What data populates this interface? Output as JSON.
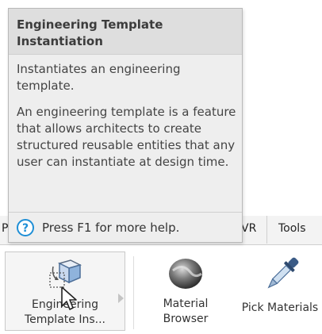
{
  "tooltip": {
    "title": "Engineering Template Instantiation",
    "description": "Instantiates an engineering template.",
    "details": "An engineering template is a feature that allows architects to create structured reusable entities that any user can instantiate at design time.",
    "help_text": "Press F1 for more help."
  },
  "ribbon": {
    "tabs": {
      "left_clipped": "P",
      "vr": "VR",
      "tools": "Tools"
    },
    "buttons": {
      "engineering_template": "Engineering Template Ins...",
      "material_browser": "Material Browser",
      "pick_materials": "Pick Materials"
    }
  },
  "colors": {
    "help_icon": "#1f8fd6",
    "tooltip_bg": "#eeeeee",
    "title_bg": "#dedede"
  }
}
